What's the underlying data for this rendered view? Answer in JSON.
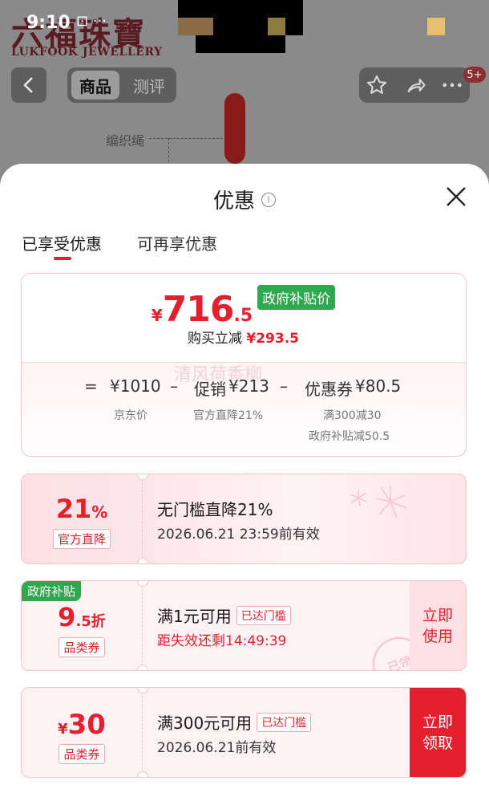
{
  "status_bar": {
    "time": "9:10",
    "icons": "⊡ ···"
  },
  "brand": {
    "logo_cn": "六福珠寶",
    "logo_en": "LUKFOOK JEWELLERY"
  },
  "nav": {
    "back_icon": "chevron-left-icon",
    "tabs": [
      {
        "label": "商品",
        "active": true
      },
      {
        "label": "测评",
        "active": false
      }
    ],
    "actions": [
      "star-icon",
      "share-icon",
      "more-icon"
    ],
    "badge": "5+"
  },
  "product_image": {
    "annotation": "编织绳"
  },
  "sheet": {
    "title": "优惠",
    "tabs": [
      {
        "label": "已享受优惠",
        "active": true
      },
      {
        "label": "可再享优惠",
        "active": false
      }
    ],
    "summary": {
      "currency": "¥",
      "price_int": "716",
      "price_dec": ".5",
      "price_tag": "政府补贴价",
      "reduce_label": "购买立减",
      "reduce_value": "¥293.5",
      "watermark": "清风荷香柳",
      "eq": "=",
      "minus": "–",
      "jd_price": "¥1010",
      "jd_label": "京东价",
      "promo_label": "促销",
      "promo_value": "¥213",
      "promo_sub": "官方直降21%",
      "coupon_label": "优惠券",
      "coupon_value": "¥80.5",
      "coupon_sub1": "满300减30",
      "coupon_sub2": "政府补贴减50.5"
    },
    "coupons": [
      {
        "value_main": "21",
        "value_unit": "%",
        "tag": "官方直降",
        "title": "无门槛直降21%",
        "subtitle": "2026.06.21 23:59前有效"
      },
      {
        "corner": "政府补贴",
        "value_main": "9",
        "value_unit": ".5折",
        "tag": "品类券",
        "title": "满1元可用",
        "threshold": "已达门槛",
        "subtitle": "距失效还剩14:49:39",
        "button": "立即使用",
        "stamp": "已领"
      },
      {
        "value_prefix": "¥",
        "value_main": "30",
        "tag": "品类券",
        "title": "满300元可用",
        "threshold": "已达门槛",
        "subtitle": "2026.06.21前有效",
        "button": "立即领取"
      }
    ]
  },
  "colors": {
    "accent": "#e4202f",
    "gov_green": "#2fa84f",
    "card_border": "#f6c6cb"
  }
}
